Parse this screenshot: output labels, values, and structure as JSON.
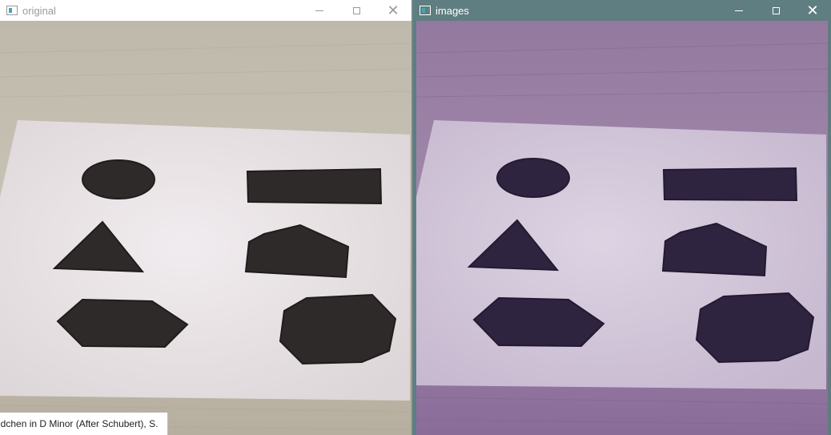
{
  "windows": {
    "original": {
      "title": "original",
      "icon": "opencv-window-icon",
      "active": false
    },
    "images": {
      "title": "images",
      "icon": "opencv-window-icon",
      "active": true
    }
  },
  "controls": {
    "minimize": "minimize-icon",
    "maximize": "maximize-icon",
    "close": "close-icon"
  },
  "caption": {
    "text": "ndchen in D Minor (After Schubert), S."
  },
  "colors": {
    "active_titlebar": "#5f7e81",
    "inactive_titlebar": "#ffffff",
    "shape_fill_original": "#2e2a2a",
    "shape_fill_images": "#2f2440",
    "paper_original": "#ece7ea",
    "paper_images": "#d9cfe0",
    "table_original": "#b9b2a3",
    "table_images": "#8a6e9b"
  },
  "shapes": [
    "ellipse",
    "rectangle",
    "triangle",
    "pentagon",
    "hexagon",
    "octagon"
  ]
}
